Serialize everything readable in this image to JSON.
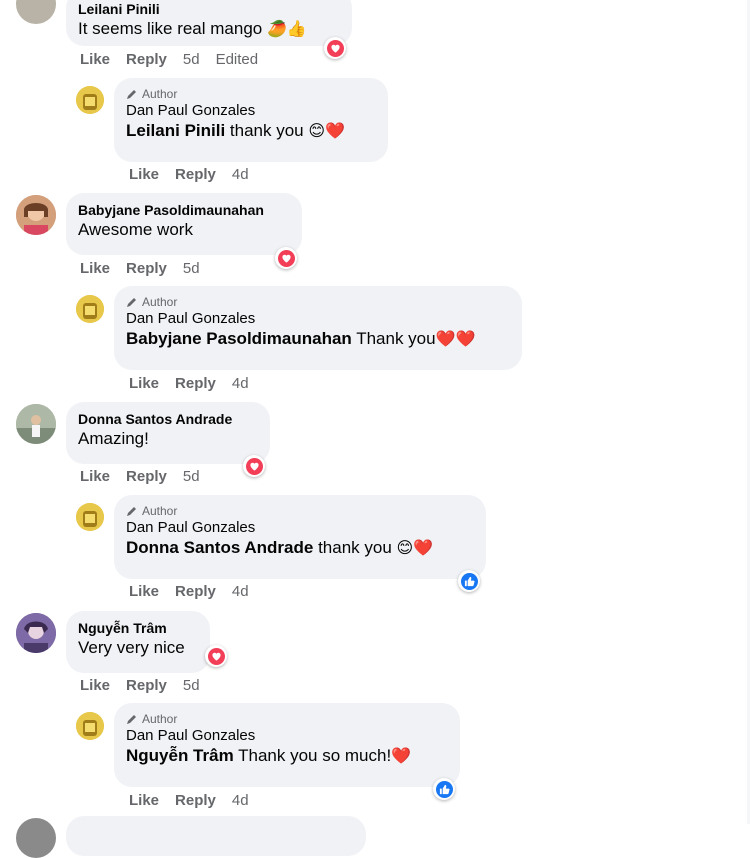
{
  "comments": [
    {
      "name": "Leilani Pinili",
      "text": "It seems like real mango",
      "emojis": "🥭👍",
      "actions": {
        "like": "Like",
        "reply": "Reply",
        "time": "5d",
        "edited": "Edited"
      },
      "reply": {
        "badge": "Author",
        "name": "Dan Paul Gonzales",
        "mention": "Leilani Pinili",
        "text": " thank you ",
        "emojis": "😊❤️",
        "actions": {
          "like": "Like",
          "reply": "Reply",
          "time": "4d"
        }
      }
    },
    {
      "name": "Babyjane Pasoldimaunahan",
      "text": "Awesome work",
      "actions": {
        "like": "Like",
        "reply": "Reply",
        "time": "5d"
      },
      "reply": {
        "badge": "Author",
        "name": "Dan Paul Gonzales",
        "mention": "Babyjane Pasoldimaunahan",
        "text": " Thank you",
        "emojis": "❤️❤️",
        "actions": {
          "like": "Like",
          "reply": "Reply",
          "time": "4d"
        }
      }
    },
    {
      "name": "Donna Santos Andrade",
      "text": "Amazing!",
      "actions": {
        "like": "Like",
        "reply": "Reply",
        "time": "5d"
      },
      "reply": {
        "badge": "Author",
        "name": "Dan Paul Gonzales",
        "mention": "Donna Santos Andrade",
        "text": " thank you ",
        "emojis": "😊❤️",
        "actions": {
          "like": "Like",
          "reply": "Reply",
          "time": "4d"
        }
      }
    },
    {
      "name": "Nguyễn Trâm",
      "text": "Very very nice",
      "actions": {
        "like": "Like",
        "reply": "Reply",
        "time": "5d"
      },
      "reply": {
        "badge": "Author",
        "name": "Dan Paul Gonzales",
        "mention": "Nguyễn Trâm",
        "text": " Thank you so much!",
        "emojis": "❤️",
        "actions": {
          "like": "Like",
          "reply": "Reply",
          "time": "4d"
        }
      }
    }
  ],
  "colors": {
    "bubble": "#f0f2f5",
    "muted": "#65676b",
    "love": "#f33e58",
    "like": "#1877f2"
  }
}
